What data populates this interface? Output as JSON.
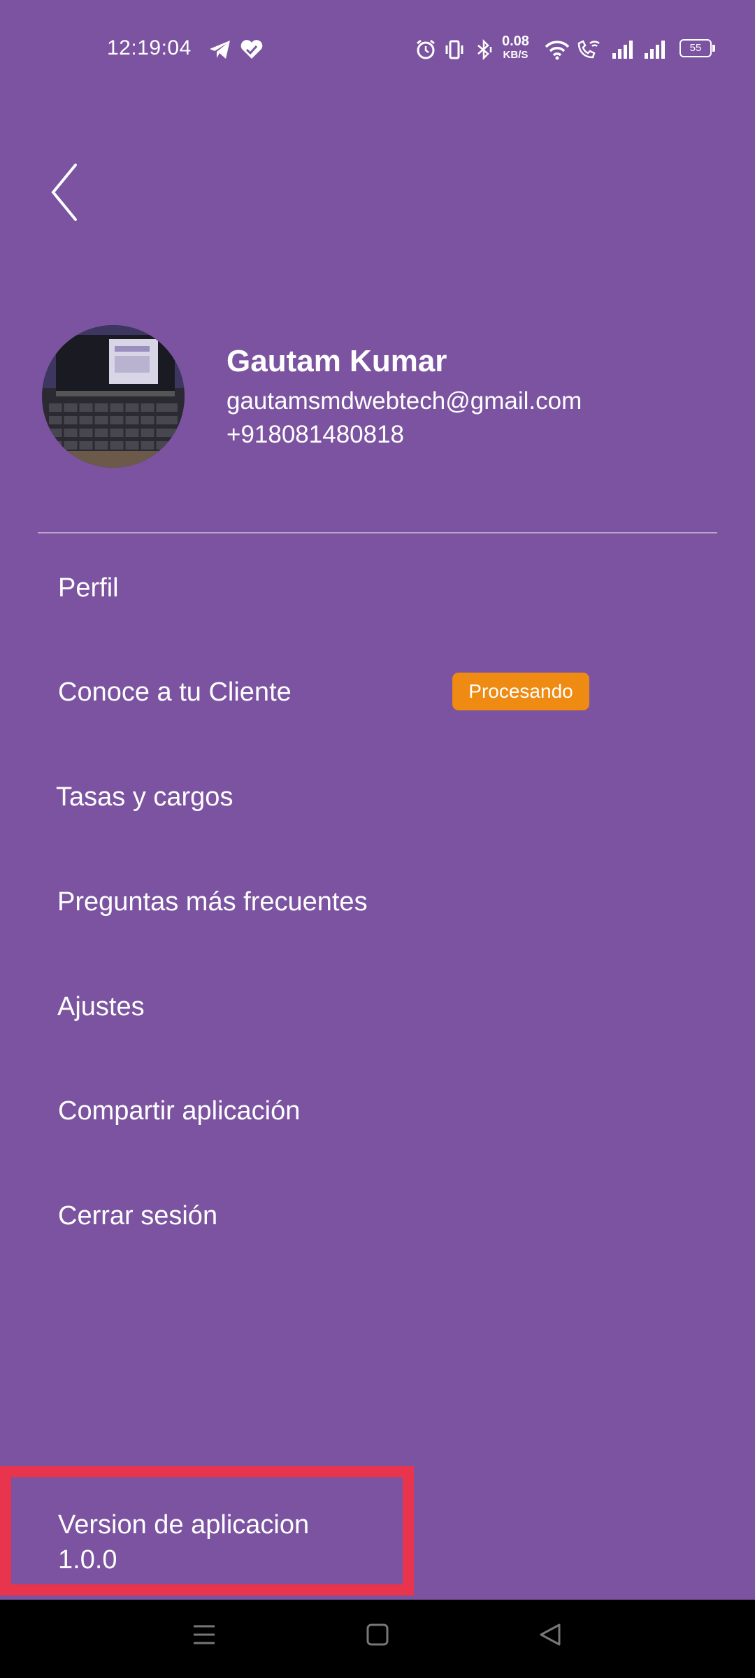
{
  "status_bar": {
    "time": "12:19:04",
    "net_speed_value": "0.08",
    "net_speed_unit": "KB/S",
    "battery_level": "55",
    "icons": [
      "telegram-icon",
      "heart-icon",
      "alarm-icon",
      "vibrate-icon",
      "bluetooth-icon",
      "wifi-icon",
      "wifi-calling-icon",
      "signal-icon",
      "signal-icon",
      "battery-icon"
    ]
  },
  "header": {
    "back_icon": "chevron-left-icon"
  },
  "user": {
    "name": "Gautam Kumar",
    "email": "gautamsmdwebtech@gmail.com",
    "phone": "+918081480818"
  },
  "menu": {
    "items": [
      {
        "label": "Perfil"
      },
      {
        "label": "Conoce a tu Cliente",
        "badge": "Procesando"
      },
      {
        "label": "Tasas y cargos"
      },
      {
        "label": "Preguntas más frecuentes"
      },
      {
        "label": "Ajustes"
      },
      {
        "label": "Compartir aplicación"
      },
      {
        "label": "Cerrar sesión"
      }
    ]
  },
  "app_version": {
    "label": "Version de aplicacion",
    "number": "1.0.0"
  },
  "colors": {
    "background": "#7b53a0",
    "badge": "#ef8a12",
    "highlight": "#e8344d",
    "nav_bar": "#000000"
  },
  "nav_bar": {
    "icons": [
      "menu-icon",
      "home-icon",
      "back-icon"
    ]
  }
}
